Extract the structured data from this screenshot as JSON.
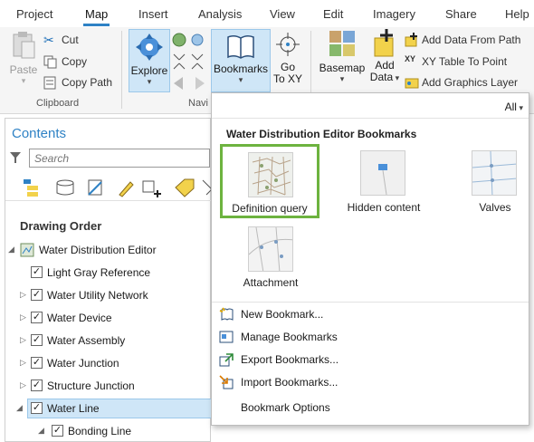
{
  "ribbon_tabs": [
    "Project",
    "Map",
    "Insert",
    "Analysis",
    "View",
    "Edit",
    "Imagery",
    "Share",
    "Help"
  ],
  "clipboard": {
    "paste": "Paste",
    "cut": "Cut",
    "copy": "Copy",
    "copy_path": "Copy Path",
    "group_label": "Clipboard"
  },
  "navigate": {
    "explore": "Explore",
    "bookmarks": "Bookmarks",
    "go_to_xy": "Go\nTo XY",
    "go": "Go",
    "to_xy": "To XY",
    "group_label": "Navi"
  },
  "layer": {
    "basemap": "Basemap",
    "add_data": "Add",
    "add_data2": "Data",
    "add_data_from_path": "Add Data From Path",
    "xy_table_to_point": "XY Table To Point",
    "add_graphics_layer": "Add Graphics Layer"
  },
  "contents": {
    "title": "Contents",
    "search_placeholder": "Search",
    "drawing_order": "Drawing Order",
    "map_name": "Water Distribution Editor",
    "layers": [
      {
        "name": "Light Gray Reference",
        "checked": true,
        "expandable": false
      },
      {
        "name": "Water Utility Network",
        "checked": true,
        "expandable": true
      },
      {
        "name": "Water Device",
        "checked": true,
        "expandable": true
      },
      {
        "name": "Water Assembly",
        "checked": true,
        "expandable": true
      },
      {
        "name": "Water Junction",
        "checked": true,
        "expandable": true
      },
      {
        "name": "Structure Junction",
        "checked": true,
        "expandable": true
      },
      {
        "name": "Water Line",
        "checked": true,
        "expandable": true,
        "selected": true
      },
      {
        "name": "Bonding Line",
        "checked": true,
        "expandable": true
      }
    ]
  },
  "dropdown": {
    "filter": "All",
    "section_title": "Water Distribution Editor Bookmarks",
    "bookmarks": [
      {
        "label": "Definition query",
        "selected": true
      },
      {
        "label": "Hidden content",
        "selected": false
      },
      {
        "label": "Valves",
        "selected": false
      },
      {
        "label": "Attachment",
        "selected": false
      }
    ],
    "menu": [
      {
        "label": "New Bookmark...",
        "icon": "new-bookmark-icon"
      },
      {
        "label": "Manage Bookmarks",
        "icon": "manage-bookmarks-icon"
      },
      {
        "label": "Export Bookmarks...",
        "icon": "export-bookmarks-icon"
      },
      {
        "label": "Import Bookmarks...",
        "icon": "import-bookmarks-icon"
      },
      {
        "label": "Bookmark Options",
        "icon": ""
      }
    ]
  },
  "colors": {
    "accent": "#2f82c5",
    "selection": "#cfe6f7",
    "bookmark_highlight": "#6db33f"
  }
}
